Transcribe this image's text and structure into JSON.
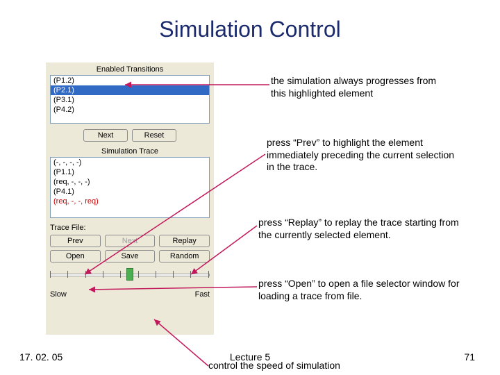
{
  "title": "Simulation Control",
  "panel": {
    "enabled_header": "Enabled Transitions",
    "enabled_list": [
      "(P1.2)",
      "(P2.1)",
      "(P3.1)",
      "(P4.2)"
    ],
    "enabled_selected_index": 1,
    "next_btn": "Next",
    "reset_btn": "Reset",
    "trace_header": "Simulation Trace",
    "trace_list": [
      "(-, -, -, -)",
      "(P1.1)",
      "(req, -, -, -)",
      "(P4.1)",
      "(req, -, -, req)"
    ],
    "trace_red_index": 4,
    "trace_file_label": "Trace File:",
    "prev_btn": "Prev",
    "next2_btn": "Next",
    "replay_btn": "Replay",
    "open_btn": "Open",
    "save_btn": "Save",
    "random_btn": "Random",
    "slow_label": "Slow",
    "fast_label": "Fast"
  },
  "annotations": {
    "a1": "the simulation always progresses from this highlighted element",
    "a2": "press “Prev” to highlight the element immediately preceding the current selection in the trace.",
    "a3": "press “Replay” to replay the trace starting from the currently selected element.",
    "a4": "press “Open” to open a file selector window for loading a trace from file.",
    "a5": "control the speed of simulation"
  },
  "footer": {
    "date": "17. 02. 05",
    "center": "Lecture 5",
    "page": "71"
  }
}
